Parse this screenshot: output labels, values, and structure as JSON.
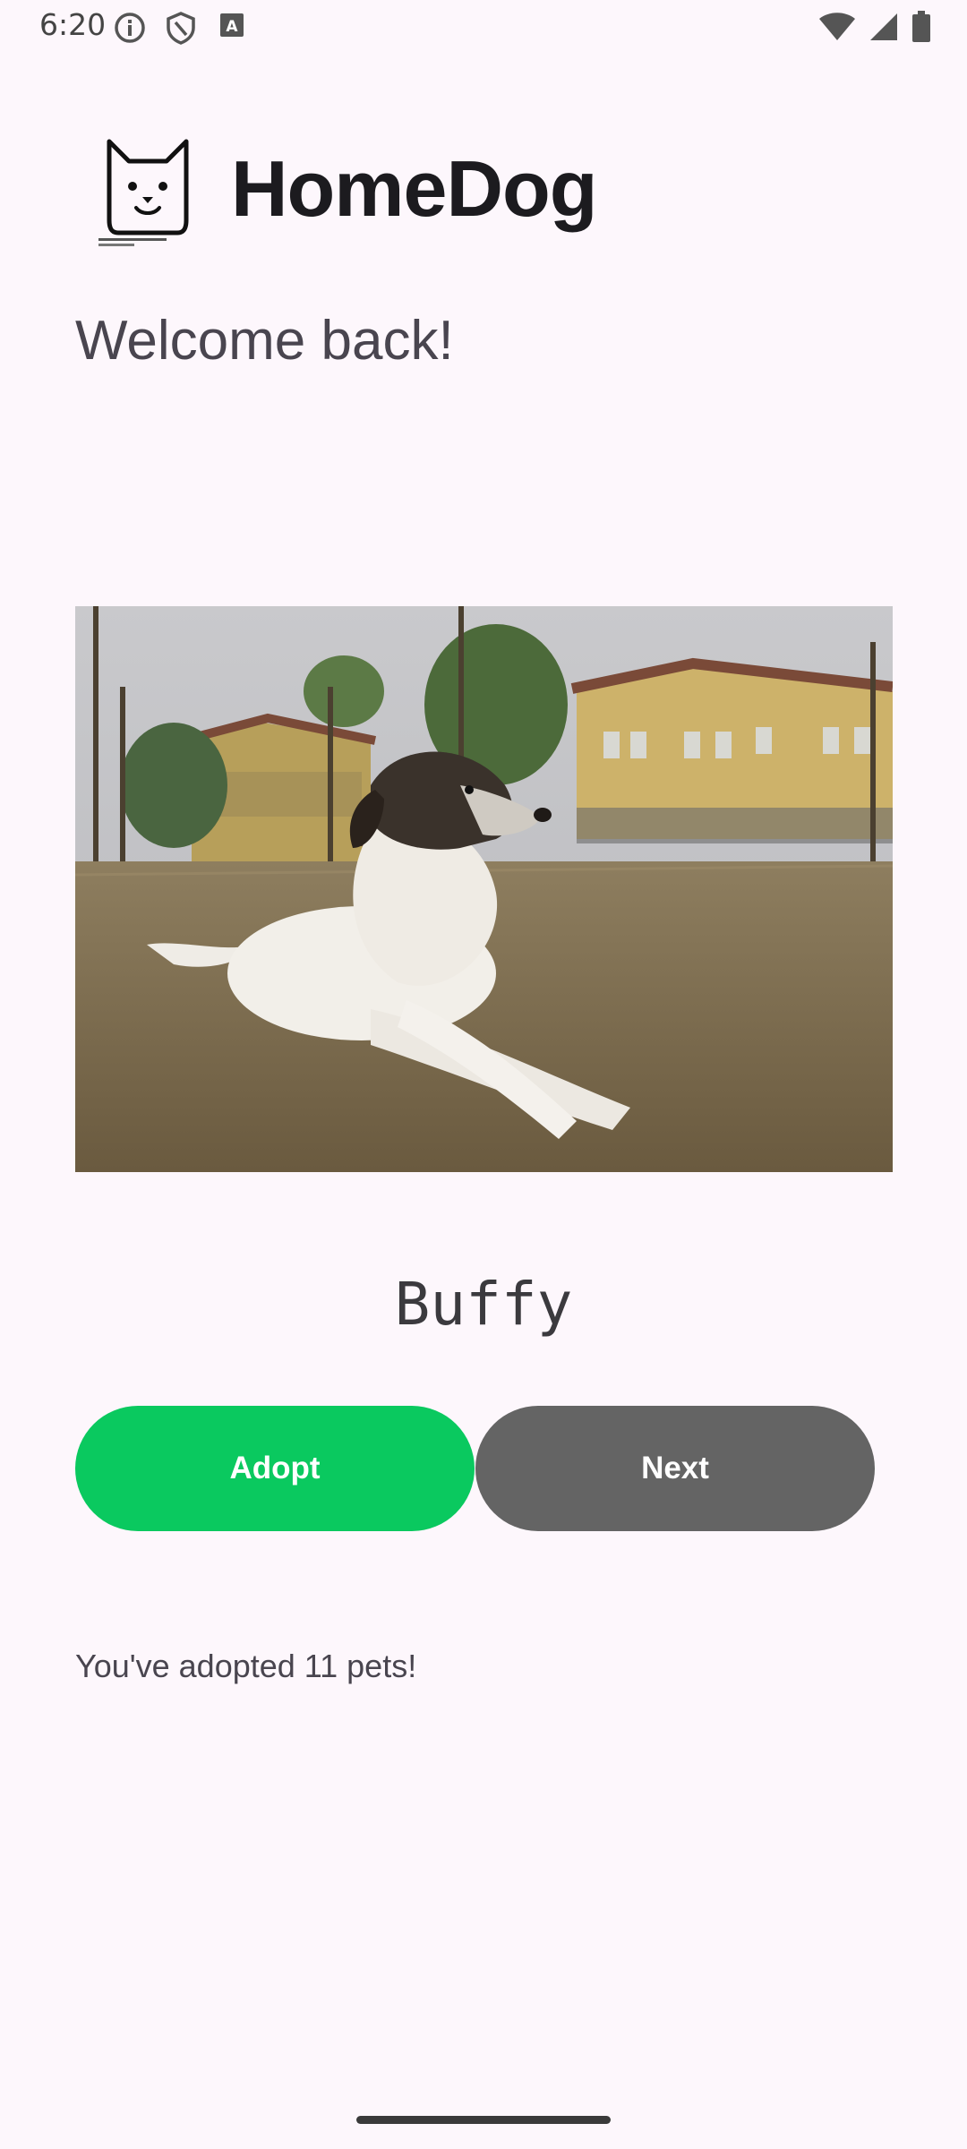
{
  "status_bar": {
    "time": "6:20",
    "icons": [
      "info-icon",
      "shield-icon",
      "keyboard-a-icon",
      "wifi-icon",
      "signal-icon",
      "battery-icon"
    ]
  },
  "header": {
    "title": "HomeDog",
    "logo_icon": "dog-face-icon"
  },
  "welcome_text": "Welcome back!",
  "pet": {
    "name": "Buffy",
    "photo": "dog-photo"
  },
  "buttons": {
    "adopt_label": "Adopt",
    "next_label": "Next"
  },
  "footer_text": "You've adopted 11 pets!",
  "colors": {
    "background": "#fdf7fc",
    "adopt": "#0ac95f",
    "next": "#646464"
  }
}
